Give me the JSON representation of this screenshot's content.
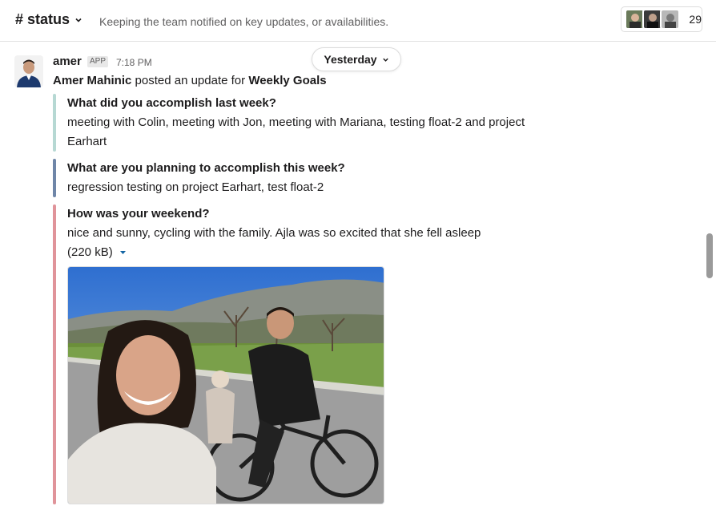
{
  "header": {
    "channel_name": "# status",
    "topic": "Keeping the team notified on key updates, or availabilities.",
    "member_count": "29"
  },
  "date_divider": {
    "label": "Yesterday"
  },
  "message": {
    "sender": "amer",
    "badge": "APP",
    "time": "7:18 PM",
    "intro_user": "Amer Mahinic",
    "intro_text": " posted an update for ",
    "intro_target": "Weekly Goals",
    "blocks": [
      {
        "question": "What did you accomplish last week?",
        "answer": "meeting with Colin, meeting with Jon, meeting with Mariana, testing float-2 and project Earhart",
        "color": "#b6d8d3"
      },
      {
        "question": "What are you planning to accomplish this week?",
        "answer": "regression testing on project Earhart, test float-2",
        "color": "#6f86a8"
      },
      {
        "question": "How was your weekend?",
        "answer": "nice and sunny, cycling with the family. Ajla was so excited that she fell asleep",
        "attachment_size": "(220 kB)",
        "color": "#e0949a"
      }
    ]
  }
}
